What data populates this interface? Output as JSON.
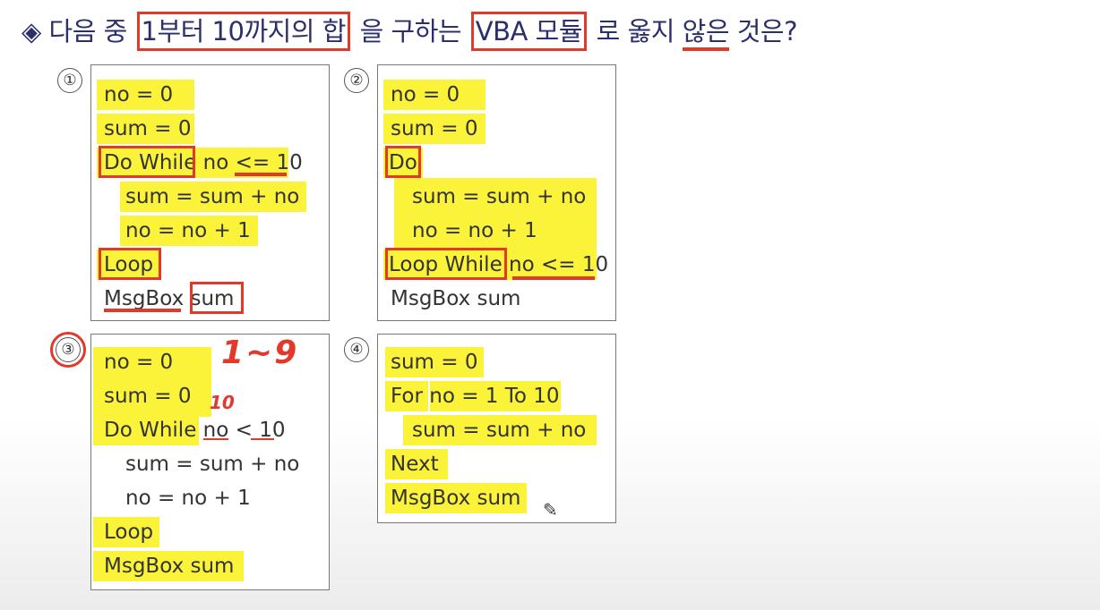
{
  "question": {
    "bullet": "◈",
    "pre": "다음 중 ",
    "highlight1": "1부터 10까지의 합",
    "mid": "을 구하는 ",
    "highlight2": "VBA 모듈",
    "post1": "로 옳지 ",
    "underlined": "않은",
    "post2": " 것은?"
  },
  "options": [
    {
      "number": "①",
      "lines": [
        "no = 0",
        "sum = 0",
        "Do While no <= 10",
        "sum = sum + no",
        "no = no + 1",
        "Loop",
        "MsgBox sum"
      ]
    },
    {
      "number": "②",
      "lines": [
        "no = 0",
        "sum = 0",
        "Do",
        "sum = sum + no",
        "no = no + 1",
        "Loop While no <= 10",
        "MsgBox sum"
      ]
    },
    {
      "number": "③",
      "lines": [
        "no = 0",
        "sum = 0",
        "Do While no < 10",
        "sum = sum + no",
        "no = no + 1",
        "Loop",
        "MsgBox sum"
      ]
    },
    {
      "number": "④",
      "lines": [
        "sum = 0",
        "For no = 1 To 10",
        "sum = sum + no",
        "Next",
        "MsgBox sum"
      ]
    }
  ],
  "annotations": {
    "range_note": "1~9",
    "ten_note": "10"
  },
  "colors": {
    "highlight": "#fbf23a",
    "markup_red": "#e23a2a",
    "question_text": "#2b2f6b"
  }
}
